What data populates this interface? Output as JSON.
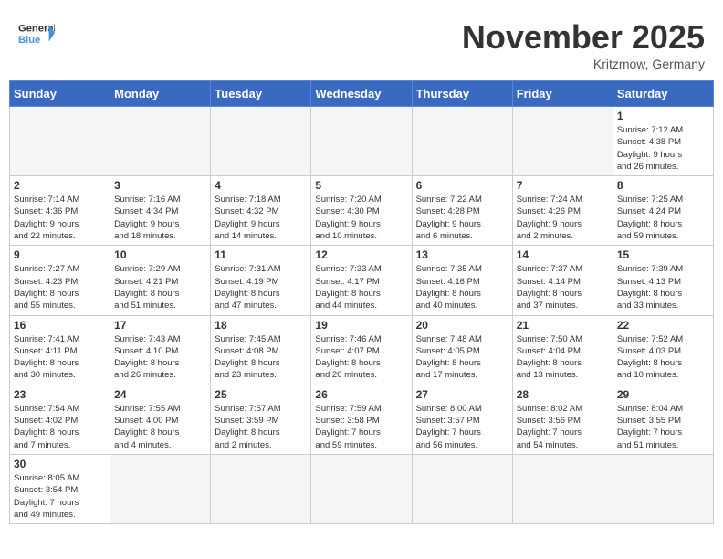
{
  "header": {
    "logo_general": "General",
    "logo_blue": "Blue",
    "month_title": "November 2025",
    "location": "Kritzmow, Germany"
  },
  "days_of_week": [
    "Sunday",
    "Monday",
    "Tuesday",
    "Wednesday",
    "Thursday",
    "Friday",
    "Saturday"
  ],
  "weeks": [
    [
      {
        "day": "",
        "info": ""
      },
      {
        "day": "",
        "info": ""
      },
      {
        "day": "",
        "info": ""
      },
      {
        "day": "",
        "info": ""
      },
      {
        "day": "",
        "info": ""
      },
      {
        "day": "",
        "info": ""
      },
      {
        "day": "1",
        "info": "Sunrise: 7:12 AM\nSunset: 4:38 PM\nDaylight: 9 hours\nand 26 minutes."
      }
    ],
    [
      {
        "day": "2",
        "info": "Sunrise: 7:14 AM\nSunset: 4:36 PM\nDaylight: 9 hours\nand 22 minutes."
      },
      {
        "day": "3",
        "info": "Sunrise: 7:16 AM\nSunset: 4:34 PM\nDaylight: 9 hours\nand 18 minutes."
      },
      {
        "day": "4",
        "info": "Sunrise: 7:18 AM\nSunset: 4:32 PM\nDaylight: 9 hours\nand 14 minutes."
      },
      {
        "day": "5",
        "info": "Sunrise: 7:20 AM\nSunset: 4:30 PM\nDaylight: 9 hours\nand 10 minutes."
      },
      {
        "day": "6",
        "info": "Sunrise: 7:22 AM\nSunset: 4:28 PM\nDaylight: 9 hours\nand 6 minutes."
      },
      {
        "day": "7",
        "info": "Sunrise: 7:24 AM\nSunset: 4:26 PM\nDaylight: 9 hours\nand 2 minutes."
      },
      {
        "day": "8",
        "info": "Sunrise: 7:25 AM\nSunset: 4:24 PM\nDaylight: 8 hours\nand 59 minutes."
      }
    ],
    [
      {
        "day": "9",
        "info": "Sunrise: 7:27 AM\nSunset: 4:23 PM\nDaylight: 8 hours\nand 55 minutes."
      },
      {
        "day": "10",
        "info": "Sunrise: 7:29 AM\nSunset: 4:21 PM\nDaylight: 8 hours\nand 51 minutes."
      },
      {
        "day": "11",
        "info": "Sunrise: 7:31 AM\nSunset: 4:19 PM\nDaylight: 8 hours\nand 47 minutes."
      },
      {
        "day": "12",
        "info": "Sunrise: 7:33 AM\nSunset: 4:17 PM\nDaylight: 8 hours\nand 44 minutes."
      },
      {
        "day": "13",
        "info": "Sunrise: 7:35 AM\nSunset: 4:16 PM\nDaylight: 8 hours\nand 40 minutes."
      },
      {
        "day": "14",
        "info": "Sunrise: 7:37 AM\nSunset: 4:14 PM\nDaylight: 8 hours\nand 37 minutes."
      },
      {
        "day": "15",
        "info": "Sunrise: 7:39 AM\nSunset: 4:13 PM\nDaylight: 8 hours\nand 33 minutes."
      }
    ],
    [
      {
        "day": "16",
        "info": "Sunrise: 7:41 AM\nSunset: 4:11 PM\nDaylight: 8 hours\nand 30 minutes."
      },
      {
        "day": "17",
        "info": "Sunrise: 7:43 AM\nSunset: 4:10 PM\nDaylight: 8 hours\nand 26 minutes."
      },
      {
        "day": "18",
        "info": "Sunrise: 7:45 AM\nSunset: 4:08 PM\nDaylight: 8 hours\nand 23 minutes."
      },
      {
        "day": "19",
        "info": "Sunrise: 7:46 AM\nSunset: 4:07 PM\nDaylight: 8 hours\nand 20 minutes."
      },
      {
        "day": "20",
        "info": "Sunrise: 7:48 AM\nSunset: 4:05 PM\nDaylight: 8 hours\nand 17 minutes."
      },
      {
        "day": "21",
        "info": "Sunrise: 7:50 AM\nSunset: 4:04 PM\nDaylight: 8 hours\nand 13 minutes."
      },
      {
        "day": "22",
        "info": "Sunrise: 7:52 AM\nSunset: 4:03 PM\nDaylight: 8 hours\nand 10 minutes."
      }
    ],
    [
      {
        "day": "23",
        "info": "Sunrise: 7:54 AM\nSunset: 4:02 PM\nDaylight: 8 hours\nand 7 minutes."
      },
      {
        "day": "24",
        "info": "Sunrise: 7:55 AM\nSunset: 4:00 PM\nDaylight: 8 hours\nand 4 minutes."
      },
      {
        "day": "25",
        "info": "Sunrise: 7:57 AM\nSunset: 3:59 PM\nDaylight: 8 hours\nand 2 minutes."
      },
      {
        "day": "26",
        "info": "Sunrise: 7:59 AM\nSunset: 3:58 PM\nDaylight: 7 hours\nand 59 minutes."
      },
      {
        "day": "27",
        "info": "Sunrise: 8:00 AM\nSunset: 3:57 PM\nDaylight: 7 hours\nand 56 minutes."
      },
      {
        "day": "28",
        "info": "Sunrise: 8:02 AM\nSunset: 3:56 PM\nDaylight: 7 hours\nand 54 minutes."
      },
      {
        "day": "29",
        "info": "Sunrise: 8:04 AM\nSunset: 3:55 PM\nDaylight: 7 hours\nand 51 minutes."
      }
    ],
    [
      {
        "day": "30",
        "info": "Sunrise: 8:05 AM\nSunset: 3:54 PM\nDaylight: 7 hours\nand 49 minutes."
      },
      {
        "day": "",
        "info": ""
      },
      {
        "day": "",
        "info": ""
      },
      {
        "day": "",
        "info": ""
      },
      {
        "day": "",
        "info": ""
      },
      {
        "day": "",
        "info": ""
      },
      {
        "day": "",
        "info": ""
      }
    ]
  ]
}
